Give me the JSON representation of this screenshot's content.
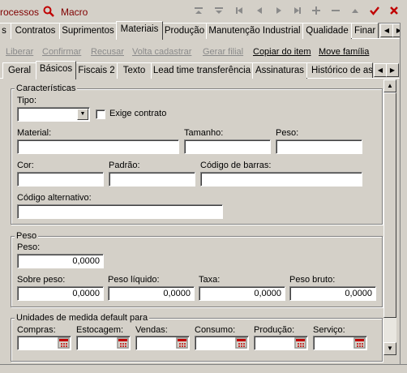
{
  "toolbar": {
    "processos": "rocessos",
    "macro": "Macro",
    "icons": [
      "move-up",
      "move-down",
      "first",
      "prev",
      "next",
      "last",
      "add",
      "remove",
      "collapse",
      "confirm",
      "close"
    ]
  },
  "module_tabs": {
    "items": [
      "s",
      "Contratos",
      "Suprimentos",
      "Materiais",
      "Produção",
      "Manutenção Industrial",
      "Qualidade",
      "Finar"
    ],
    "active": "Materiais"
  },
  "actions": {
    "liberar": "Liberar",
    "confirmar": "Confirmar",
    "recusar": "Recusar",
    "volta_cadastrar": "Volta cadastrar",
    "gerar_filial": "Gerar filial",
    "copiar_item": "Copiar do item",
    "move_familia": "Move família"
  },
  "sub_tabs": {
    "items": [
      "Geral",
      "Básicos",
      "Fiscais 2",
      "Texto",
      "Lead time transferência",
      "Assinaturas",
      "Histórico de ass"
    ],
    "active": "Básicos"
  },
  "caracteristicas": {
    "title": "Características",
    "tipo_label": "Tipo:",
    "tipo_value": "",
    "exige_contrato_label": "Exige contrato",
    "exige_contrato_checked": false,
    "material_label": "Material:",
    "tamanho_label": "Tamanho:",
    "peso_label": "Peso:",
    "cor_label": "Cor:",
    "padrao_label": "Padrão:",
    "codigo_barras_label": "Código de barras:",
    "codigo_alternativo_label": "Código alternativo:"
  },
  "peso": {
    "title": "Peso",
    "peso_label": "Peso:",
    "peso_value": "0,0000",
    "sobre_peso_label": "Sobre peso:",
    "sobre_peso_value": "0,0000",
    "peso_liquido_label": "Peso líquido:",
    "peso_liquido_value": "0,0000",
    "taxa_label": "Taxa:",
    "taxa_value": "0,0000",
    "peso_bruto_label": "Peso bruto:",
    "peso_bruto_value": "0,0000"
  },
  "unidades": {
    "title": "Unidades de medida default para",
    "labels": [
      "Compras:",
      "Estocagem:",
      "Vendas:",
      "Consumo:",
      "Produção:",
      "Serviço:"
    ]
  },
  "colors": {
    "accent": "#800000",
    "confirm": "#c00000",
    "background": "#d4d0c8"
  }
}
